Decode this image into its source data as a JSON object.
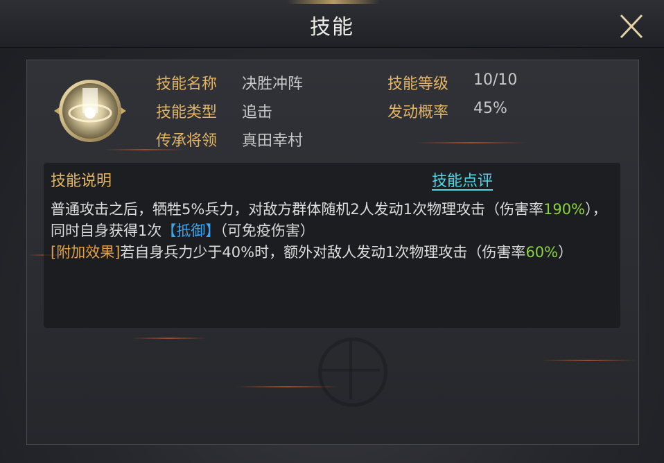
{
  "header": {
    "title": "技能"
  },
  "skill": {
    "labels": {
      "name": "技能名称",
      "type": "技能类型",
      "inherit": "传承将领",
      "level": "技能等级",
      "chance": "发动概率"
    },
    "values": {
      "name": "决胜冲阵",
      "type": "追击",
      "inherit": "真田幸村",
      "level": "10/10",
      "chance": "45%"
    }
  },
  "description": {
    "title": "技能说明",
    "review_link": "技能点评",
    "line1_a": "普通攻击之后，牺牲5%兵力，对敌方群体随机2人发动1次物理攻击（伤害率",
    "line1_rate": "190%",
    "line1_b": "），同时自身获得1次",
    "line1_buff": "【抵御】",
    "line1_c": "（可免疫伤害）",
    "line2_tag": "[附加效果]",
    "line2_a": "若自身兵力少于40%时，额外对敌人发动1次物理攻击（伤害率",
    "line2_rate": "60%",
    "line2_b": "）"
  },
  "colors": {
    "label_gold": "#e2b466",
    "highlight_green": "#8bd33a",
    "highlight_blue": "#3aa5f0",
    "link_cyan": "#4fd6e8"
  },
  "icons": {
    "close": "close-icon",
    "skill": "skill-emblem-icon"
  }
}
